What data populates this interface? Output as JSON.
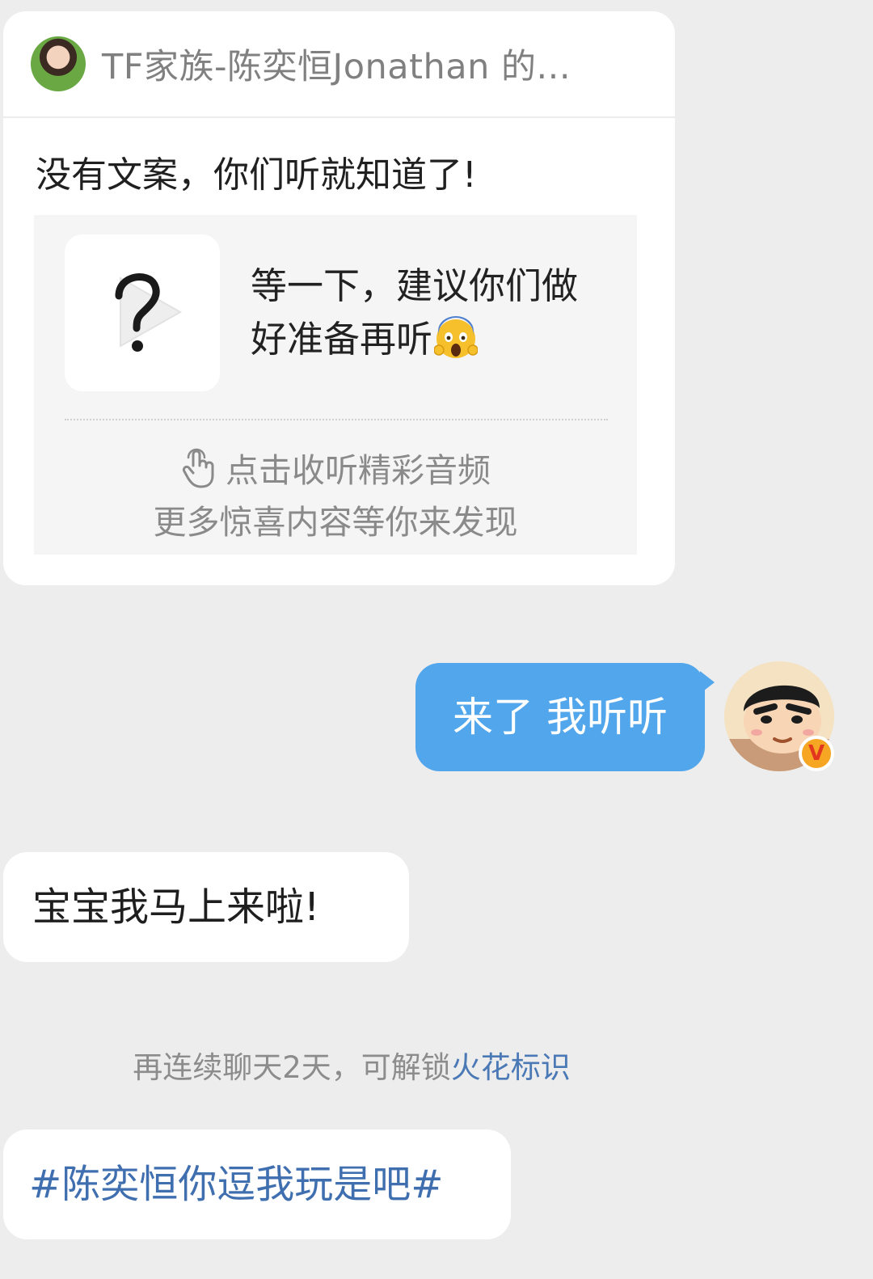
{
  "share_card": {
    "source": "TF家族-陈奕恒Jonathan 的...",
    "caption": "没有文案，你们听就知道了!",
    "audio_title": "等一下，建议你们做好准备再听",
    "tap_hint": "点击收听精彩音频",
    "more_hint": "更多惊喜内容等你来发现"
  },
  "messages": {
    "outgoing_text": "来了 我听听",
    "incoming_text": "宝宝我马上来啦!",
    "hashtag_text": "#陈奕恒你逗我玩是吧#"
  },
  "system_tip": {
    "text": "再连续聊天2天，可解锁",
    "link": "火花标识"
  },
  "icons": {
    "cover": "audio-placeholder-icon",
    "tap": "tap-hand-icon",
    "badge": "verified-v-icon",
    "emoji": "screaming-face-emoji"
  },
  "colors": {
    "background": "#ededed",
    "outgoing_bubble": "#51a6ec",
    "link_blue": "#4a79b6",
    "hashtag_blue": "#406fb0"
  }
}
